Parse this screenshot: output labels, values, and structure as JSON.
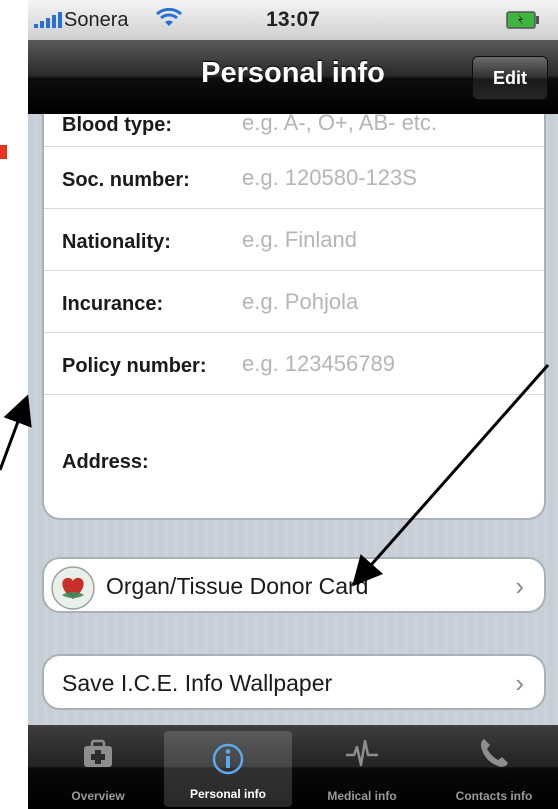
{
  "status_bar": {
    "carrier": "Sonera",
    "time": "13:07"
  },
  "nav": {
    "title": "Personal info",
    "edit_label": "Edit"
  },
  "form_rows": [
    {
      "label": "Blood type:",
      "placeholder": "e.g. A-, O+, AB- etc."
    },
    {
      "label": "Soc. number:",
      "placeholder": "e.g. 120580-123S"
    },
    {
      "label": "Nationality:",
      "placeholder": "e.g. Finland"
    },
    {
      "label": "Incurance:",
      "placeholder": "e.g. Pohjola"
    },
    {
      "label": "Policy number:",
      "placeholder": "e.g. 123456789"
    },
    {
      "label": "Address:",
      "placeholder": ""
    }
  ],
  "links": [
    {
      "label": "Organ/Tissue Donor Card",
      "icon": "donor-heart-icon"
    },
    {
      "label": "Save I.C.E. Info Wallpaper",
      "icon": ""
    }
  ],
  "tab_bar": {
    "tabs": [
      {
        "label": "Overview",
        "icon": "medkit-icon",
        "active": false
      },
      {
        "label": "Personal info",
        "icon": "info-icon",
        "active": true
      },
      {
        "label": "Medical info",
        "icon": "heartbeat-icon",
        "active": false
      },
      {
        "label": "Contacts info",
        "icon": "phone-icon",
        "active": false
      }
    ]
  },
  "colors": {
    "nav_bg": "#000000",
    "placeholder": "#b5b5b5",
    "annotation_arrow": "#000000",
    "annotation_mark": "#e8321e"
  }
}
